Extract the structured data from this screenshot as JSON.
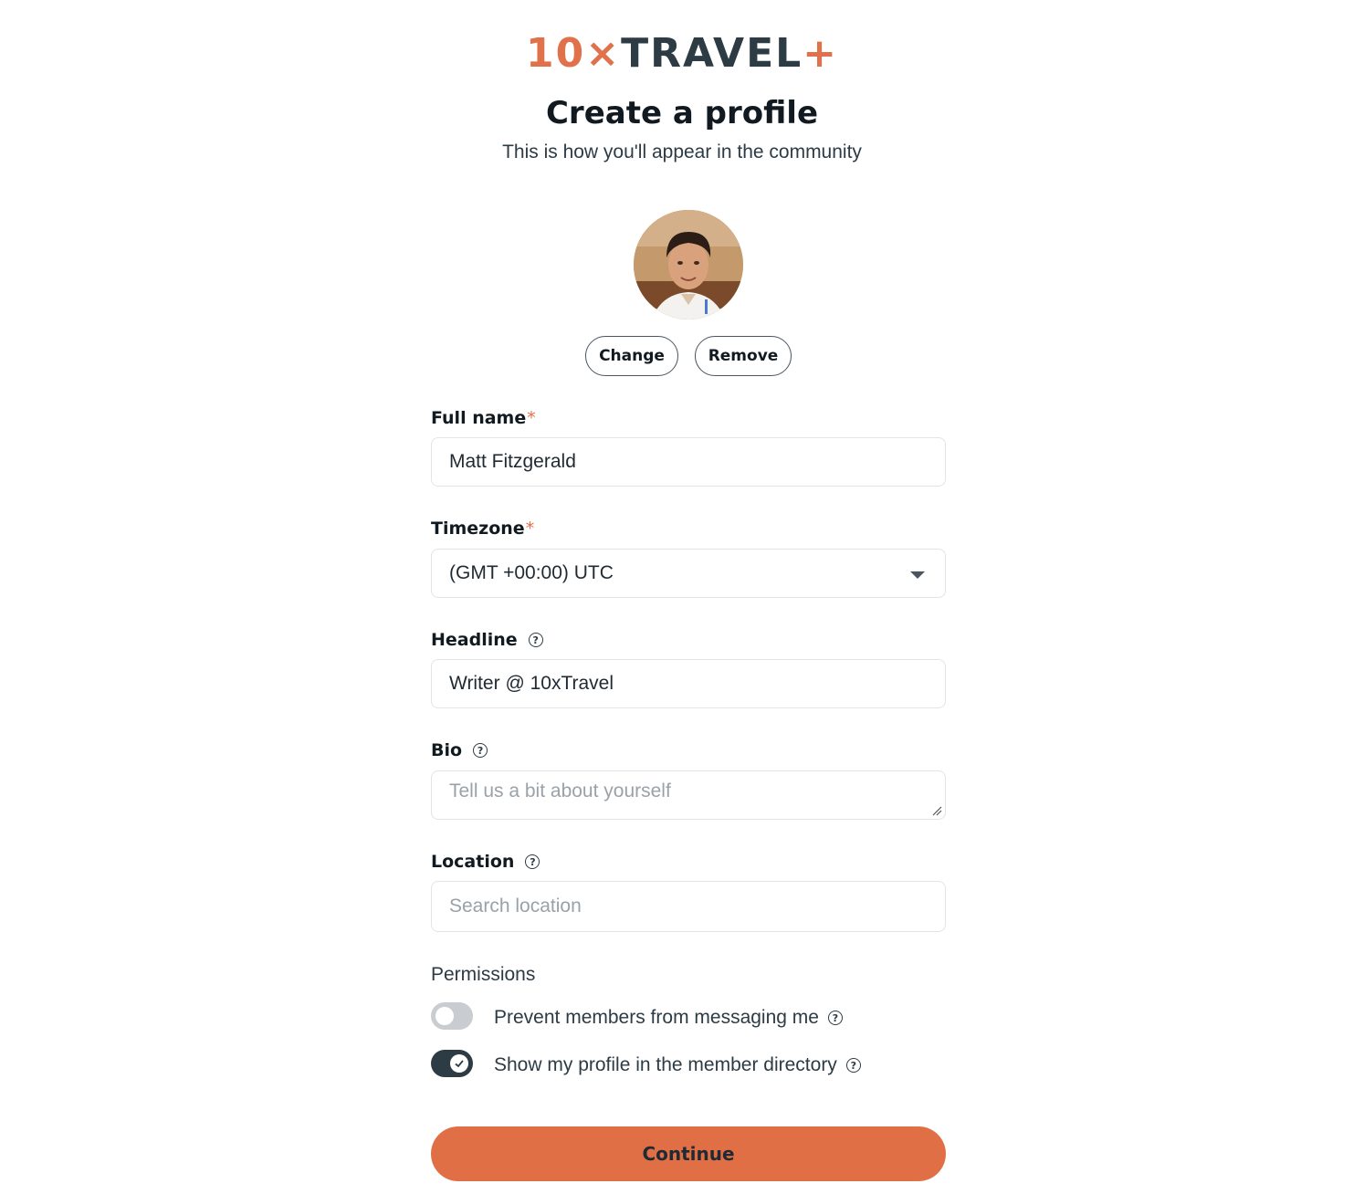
{
  "brand": {
    "logo_num": "10",
    "logo_x": "×",
    "logo_word": "TRAVEL",
    "logo_plus": "+",
    "accent": "#e06f45",
    "dark": "#2d3b45"
  },
  "header": {
    "title": "Create a profile",
    "subtitle": "This is how you'll appear in the community"
  },
  "avatar": {
    "change_label": "Change",
    "remove_label": "Remove"
  },
  "form": {
    "full_name": {
      "label": "Full name",
      "required_mark": "*",
      "value": "Matt Fitzgerald"
    },
    "timezone": {
      "label": "Timezone",
      "required_mark": "*",
      "value": "(GMT +00:00) UTC"
    },
    "headline": {
      "label": "Headline",
      "value": "Writer @ 10xTravel",
      "help_icon": "question-circle-icon"
    },
    "bio": {
      "label": "Bio",
      "placeholder": "Tell us a bit about yourself",
      "help_icon": "question-circle-icon"
    },
    "location": {
      "label": "Location",
      "placeholder": "Search location",
      "help_icon": "question-circle-icon"
    }
  },
  "permissions": {
    "title": "Permissions",
    "items": [
      {
        "label": "Prevent members from messaging me",
        "enabled": false
      },
      {
        "label": "Show my profile in the member directory",
        "enabled": true
      }
    ]
  },
  "actions": {
    "continue_label": "Continue"
  }
}
